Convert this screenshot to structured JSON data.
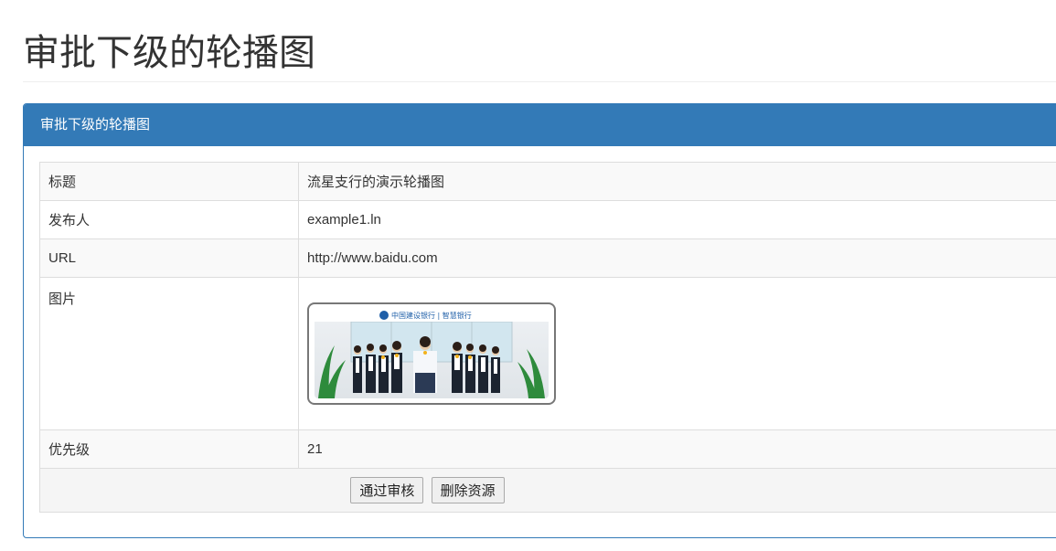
{
  "page": {
    "title": "审批下级的轮播图"
  },
  "panel": {
    "heading": "审批下级的轮播图"
  },
  "details": {
    "title_label": "标题",
    "title_value": "流星支行的演示轮播图",
    "publisher_label": "发布人",
    "publisher_value": "example1.ln",
    "url_label": "URL",
    "url_value": "http://www.baidu.com",
    "image_label": "图片",
    "image_logo_text": "中国建设银行 | 智慧银行",
    "priority_label": "优先级",
    "priority_value": "21"
  },
  "actions": {
    "approve_label": "通过审核",
    "delete_label": "删除资源"
  },
  "colors": {
    "primary": "#337ab7",
    "panel_heading_text": "#ffffff",
    "border": "#dddddd",
    "striped_row": "#f9f9f9"
  }
}
